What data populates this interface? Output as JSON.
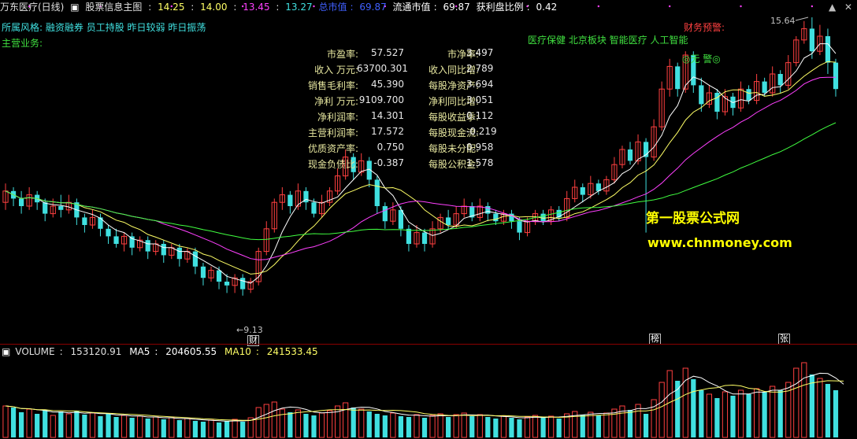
{
  "header": {
    "title": "万东医疗(日线)",
    "indicator": "股票信息主图",
    "open": "14.25",
    "high": "14.00",
    "low": "13.45",
    "close": "13.27",
    "total_mv_label": "总市值",
    "total_mv": "69.87",
    "float_mv_label": "流通市值",
    "float_mv": "69.87",
    "profit_ratio_label": "获利盘比例",
    "profit_ratio": "0.42"
  },
  "info": {
    "style_label": "所属风格",
    "style_value": "融资融券 员工持股 昨日较弱 昨日振荡",
    "business_label": "主营业务",
    "warning_label": "财务预警",
    "concepts": "医疗保健 北京板块 智能医疗 人工智能",
    "alert": "◎无  警◎"
  },
  "financials": [
    {
      "l1": "市盈率:",
      "v1": "57.527",
      "l2": "市净率:",
      "v2": "3.497"
    },
    {
      "l1": "收入 万元:",
      "v1": "63700.301",
      "l2": "收入同比增:",
      "v2": "2.789"
    },
    {
      "l1": "销售毛利率:",
      "v1": "45.390",
      "l2": "每股净资产:",
      "v2": "3.694"
    },
    {
      "l1": "净利 万元:",
      "v1": "9109.700",
      "l2": "净利同比增:",
      "v2": "3.051"
    },
    {
      "l1": "净利润率:",
      "v1": "14.301",
      "l2": "每股收益季:",
      "v2": "0.112"
    },
    {
      "l1": "主营利润率:",
      "v1": "17.572",
      "l2": "每股现金流:",
      "v2": "-0.219"
    },
    {
      "l1": "优质资产率:",
      "v1": "0.750",
      "l2": "每股未分配:",
      "v2": "0.958"
    },
    {
      "l1": "现金负债比:",
      "v1": "-0.387",
      "l2": "每股公积金:",
      "v2": "1.578"
    }
  ],
  "annotations": {
    "high_price": "15.64",
    "low_price": "9.13",
    "tag_cai": "财",
    "tag_bang": "榜",
    "tag_zhang": "张",
    "watermark_cn": "第一股票公式网",
    "watermark_url": "www.chnmoney.com"
  },
  "volume": {
    "volume_label": "VOLUME",
    "volume_value": "153120.91",
    "ma5_label": "MA5",
    "ma5_value": "204605.55",
    "ma10_label": "MA10",
    "ma10_value": "241533.45"
  },
  "colors": {
    "up": "#ff4040",
    "down": "#40e0e0",
    "ma5": "#ffffff",
    "ma10": "#ffff66",
    "ma20": "#ff40ff",
    "ma60": "#40ff40",
    "text_yellow": "#e8e8a0",
    "text_cyan": "#40e0e0"
  },
  "chart_data": {
    "type": "candlestick",
    "price_range": [
      8.0,
      16.5
    ],
    "candles": [
      {
        "o": 11.6,
        "c": 11.9,
        "h": 12.1,
        "l": 11.4
      },
      {
        "o": 11.9,
        "c": 11.7,
        "h": 12.0,
        "l": 11.5
      },
      {
        "o": 11.7,
        "c": 11.5,
        "h": 11.9,
        "l": 11.3
      },
      {
        "o": 11.5,
        "c": 11.8,
        "h": 12.0,
        "l": 11.4
      },
      {
        "o": 11.8,
        "c": 11.6,
        "h": 11.9,
        "l": 11.4
      },
      {
        "o": 11.6,
        "c": 11.3,
        "h": 11.7,
        "l": 11.1
      },
      {
        "o": 11.3,
        "c": 11.5,
        "h": 11.7,
        "l": 11.2
      },
      {
        "o": 11.5,
        "c": 11.4,
        "h": 11.8,
        "l": 11.2
      },
      {
        "o": 11.4,
        "c": 11.6,
        "h": 11.8,
        "l": 11.3
      },
      {
        "o": 11.6,
        "c": 11.2,
        "h": 11.7,
        "l": 11.0
      },
      {
        "o": 11.2,
        "c": 11.0,
        "h": 11.3,
        "l": 10.8
      },
      {
        "o": 11.0,
        "c": 11.2,
        "h": 11.4,
        "l": 10.9
      },
      {
        "o": 11.2,
        "c": 10.9,
        "h": 11.3,
        "l": 10.7
      },
      {
        "o": 10.9,
        "c": 10.7,
        "h": 11.0,
        "l": 10.5
      },
      {
        "o": 10.7,
        "c": 10.5,
        "h": 10.9,
        "l": 10.4
      },
      {
        "o": 10.5,
        "c": 10.7,
        "h": 10.8,
        "l": 10.3
      },
      {
        "o": 10.7,
        "c": 10.4,
        "h": 10.8,
        "l": 10.2
      },
      {
        "o": 10.4,
        "c": 10.6,
        "h": 10.7,
        "l": 10.3
      },
      {
        "o": 10.6,
        "c": 10.3,
        "h": 10.7,
        "l": 10.1
      },
      {
        "o": 10.3,
        "c": 10.5,
        "h": 10.6,
        "l": 10.2
      },
      {
        "o": 10.5,
        "c": 10.2,
        "h": 10.6,
        "l": 10.0
      },
      {
        "o": 10.2,
        "c": 10.4,
        "h": 10.5,
        "l": 10.1
      },
      {
        "o": 10.4,
        "c": 10.1,
        "h": 10.5,
        "l": 9.9
      },
      {
        "o": 10.1,
        "c": 10.3,
        "h": 10.4,
        "l": 10.0
      },
      {
        "o": 10.3,
        "c": 9.9,
        "h": 10.4,
        "l": 9.7
      },
      {
        "o": 9.9,
        "c": 9.6,
        "h": 10.0,
        "l": 9.4
      },
      {
        "o": 9.6,
        "c": 9.8,
        "h": 9.9,
        "l": 9.5
      },
      {
        "o": 9.8,
        "c": 9.5,
        "h": 9.9,
        "l": 9.3
      },
      {
        "o": 9.5,
        "c": 9.4,
        "h": 9.7,
        "l": 9.2
      },
      {
        "o": 9.4,
        "c": 9.6,
        "h": 9.7,
        "l": 9.2
      },
      {
        "o": 9.6,
        "c": 9.3,
        "h": 9.7,
        "l": 9.13
      },
      {
        "o": 9.3,
        "c": 9.5,
        "h": 9.6,
        "l": 9.2
      },
      {
        "o": 9.5,
        "c": 10.3,
        "h": 10.4,
        "l": 9.4
      },
      {
        "o": 10.3,
        "c": 10.9,
        "h": 11.1,
        "l": 10.2
      },
      {
        "o": 10.9,
        "c": 11.6,
        "h": 11.7,
        "l": 10.8
      },
      {
        "o": 11.6,
        "c": 11.8,
        "h": 12.0,
        "l": 11.4
      },
      {
        "o": 11.8,
        "c": 11.5,
        "h": 11.9,
        "l": 11.3
      },
      {
        "o": 11.5,
        "c": 11.9,
        "h": 12.1,
        "l": 11.4
      },
      {
        "o": 11.9,
        "c": 11.6,
        "h": 12.0,
        "l": 11.4
      },
      {
        "o": 11.6,
        "c": 11.3,
        "h": 11.7,
        "l": 11.2
      },
      {
        "o": 11.3,
        "c": 11.6,
        "h": 11.8,
        "l": 11.2
      },
      {
        "o": 11.6,
        "c": 11.9,
        "h": 12.0,
        "l": 11.5
      },
      {
        "o": 11.9,
        "c": 12.3,
        "h": 12.5,
        "l": 11.8
      },
      {
        "o": 12.3,
        "c": 12.8,
        "h": 13.0,
        "l": 12.2
      },
      {
        "o": 12.8,
        "c": 12.4,
        "h": 12.9,
        "l": 12.2
      },
      {
        "o": 12.4,
        "c": 12.7,
        "h": 12.9,
        "l": 12.3
      },
      {
        "o": 12.7,
        "c": 12.2,
        "h": 12.8,
        "l": 12.0
      },
      {
        "o": 12.2,
        "c": 11.5,
        "h": 12.3,
        "l": 11.3
      },
      {
        "o": 11.5,
        "c": 11.1,
        "h": 11.6,
        "l": 10.9
      },
      {
        "o": 11.1,
        "c": 11.4,
        "h": 11.6,
        "l": 11.0
      },
      {
        "o": 11.4,
        "c": 10.9,
        "h": 11.5,
        "l": 10.7
      },
      {
        "o": 10.9,
        "c": 10.5,
        "h": 11.0,
        "l": 10.3
      },
      {
        "o": 10.5,
        "c": 10.8,
        "h": 11.0,
        "l": 10.4
      },
      {
        "o": 10.8,
        "c": 10.5,
        "h": 10.9,
        "l": 10.3
      },
      {
        "o": 10.5,
        "c": 10.9,
        "h": 11.1,
        "l": 10.4
      },
      {
        "o": 10.9,
        "c": 11.2,
        "h": 11.3,
        "l": 10.8
      },
      {
        "o": 11.2,
        "c": 11.0,
        "h": 11.4,
        "l": 10.9
      },
      {
        "o": 11.0,
        "c": 11.3,
        "h": 11.5,
        "l": 10.9
      },
      {
        "o": 11.3,
        "c": 11.5,
        "h": 11.7,
        "l": 11.2
      },
      {
        "o": 11.5,
        "c": 11.2,
        "h": 11.6,
        "l": 11.1
      },
      {
        "o": 11.2,
        "c": 11.5,
        "h": 11.7,
        "l": 11.1
      },
      {
        "o": 11.5,
        "c": 11.3,
        "h": 11.6,
        "l": 11.1
      },
      {
        "o": 11.3,
        "c": 11.1,
        "h": 11.4,
        "l": 11.0
      },
      {
        "o": 11.1,
        "c": 11.3,
        "h": 11.4,
        "l": 11.0
      },
      {
        "o": 11.3,
        "c": 11.1,
        "h": 11.4,
        "l": 10.9
      },
      {
        "o": 11.1,
        "c": 10.8,
        "h": 11.2,
        "l": 10.6
      },
      {
        "o": 10.8,
        "c": 11.1,
        "h": 11.2,
        "l": 10.7
      },
      {
        "o": 11.1,
        "c": 11.3,
        "h": 11.4,
        "l": 11.0
      },
      {
        "o": 11.3,
        "c": 11.1,
        "h": 11.4,
        "l": 11.0
      },
      {
        "o": 11.1,
        "c": 11.4,
        "h": 11.5,
        "l": 11.0
      },
      {
        "o": 11.4,
        "c": 11.2,
        "h": 11.5,
        "l": 11.1
      },
      {
        "o": 11.2,
        "c": 11.7,
        "h": 11.9,
        "l": 11.1
      },
      {
        "o": 11.7,
        "c": 12.0,
        "h": 12.2,
        "l": 11.6
      },
      {
        "o": 12.0,
        "c": 11.8,
        "h": 12.1,
        "l": 11.6
      },
      {
        "o": 11.8,
        "c": 12.1,
        "h": 12.3,
        "l": 11.7
      },
      {
        "o": 12.1,
        "c": 11.9,
        "h": 12.2,
        "l": 11.8
      },
      {
        "o": 11.9,
        "c": 12.2,
        "h": 12.3,
        "l": 11.8
      },
      {
        "o": 12.2,
        "c": 12.6,
        "h": 12.8,
        "l": 12.1
      },
      {
        "o": 12.6,
        "c": 13.0,
        "h": 13.1,
        "l": 12.5
      },
      {
        "o": 13.0,
        "c": 12.7,
        "h": 13.2,
        "l": 12.6
      },
      {
        "o": 12.7,
        "c": 13.2,
        "h": 13.4,
        "l": 12.6
      },
      {
        "o": 13.2,
        "c": 12.8,
        "h": 13.3,
        "l": 10.8
      },
      {
        "o": 12.8,
        "c": 13.6,
        "h": 13.8,
        "l": 12.7
      },
      {
        "o": 13.6,
        "c": 14.6,
        "h": 14.8,
        "l": 13.5
      },
      {
        "o": 14.6,
        "c": 15.2,
        "h": 15.4,
        "l": 14.4
      },
      {
        "o": 15.2,
        "c": 14.6,
        "h": 15.3,
        "l": 14.4
      },
      {
        "o": 14.6,
        "c": 15.5,
        "h": 15.6,
        "l": 14.5
      },
      {
        "o": 15.5,
        "c": 14.7,
        "h": 15.6,
        "l": 14.5
      },
      {
        "o": 14.7,
        "c": 14.2,
        "h": 14.9,
        "l": 14.0
      },
      {
        "o": 14.2,
        "c": 14.5,
        "h": 14.7,
        "l": 14.1
      },
      {
        "o": 14.5,
        "c": 14.0,
        "h": 14.6,
        "l": 13.8
      },
      {
        "o": 14.0,
        "c": 14.4,
        "h": 14.6,
        "l": 13.9
      },
      {
        "o": 14.4,
        "c": 14.1,
        "h": 14.5,
        "l": 13.9
      },
      {
        "o": 14.1,
        "c": 14.6,
        "h": 14.8,
        "l": 14.0
      },
      {
        "o": 14.6,
        "c": 14.3,
        "h": 14.7,
        "l": 14.2
      },
      {
        "o": 14.3,
        "c": 14.8,
        "h": 15.0,
        "l": 14.2
      },
      {
        "o": 14.8,
        "c": 14.5,
        "h": 14.9,
        "l": 14.4
      },
      {
        "o": 14.5,
        "c": 15.0,
        "h": 15.2,
        "l": 14.4
      },
      {
        "o": 15.0,
        "c": 14.7,
        "h": 15.1,
        "l": 14.5
      },
      {
        "o": 14.7,
        "c": 15.3,
        "h": 15.5,
        "l": 14.6
      },
      {
        "o": 15.3,
        "c": 15.9,
        "h": 16.0,
        "l": 15.2
      },
      {
        "o": 15.9,
        "c": 16.2,
        "h": 16.4,
        "l": 15.8
      },
      {
        "o": 16.2,
        "c": 15.6,
        "h": 16.5,
        "l": 15.4
      },
      {
        "o": 15.6,
        "c": 16.0,
        "h": 16.3,
        "l": 15.5
      },
      {
        "o": 16.0,
        "c": 15.3,
        "h": 16.2,
        "l": 15.0
      },
      {
        "o": 15.3,
        "c": 14.6,
        "h": 15.4,
        "l": 14.4
      }
    ],
    "volumes": [
      40,
      38,
      32,
      36,
      30,
      35,
      28,
      33,
      30,
      34,
      29,
      31,
      27,
      30,
      26,
      28,
      25,
      27,
      24,
      26,
      23,
      25,
      22,
      24,
      21,
      20,
      22,
      19,
      21,
      23,
      20,
      25,
      38,
      42,
      45,
      36,
      32,
      35,
      30,
      28,
      31,
      34,
      40,
      44,
      38,
      36,
      33,
      30,
      28,
      31,
      27,
      26,
      29,
      25,
      28,
      30,
      26,
      29,
      31,
      27,
      29,
      26,
      24,
      27,
      25,
      23,
      26,
      28,
      25,
      27,
      24,
      30,
      33,
      29,
      32,
      28,
      31,
      36,
      40,
      35,
      42,
      30,
      48,
      70,
      85,
      72,
      88,
      74,
      60,
      55,
      50,
      58,
      53,
      60,
      55,
      62,
      58,
      65,
      60,
      70,
      88,
      95,
      80,
      75,
      68,
      60,
      55
    ],
    "volume_axis_max": 100
  }
}
